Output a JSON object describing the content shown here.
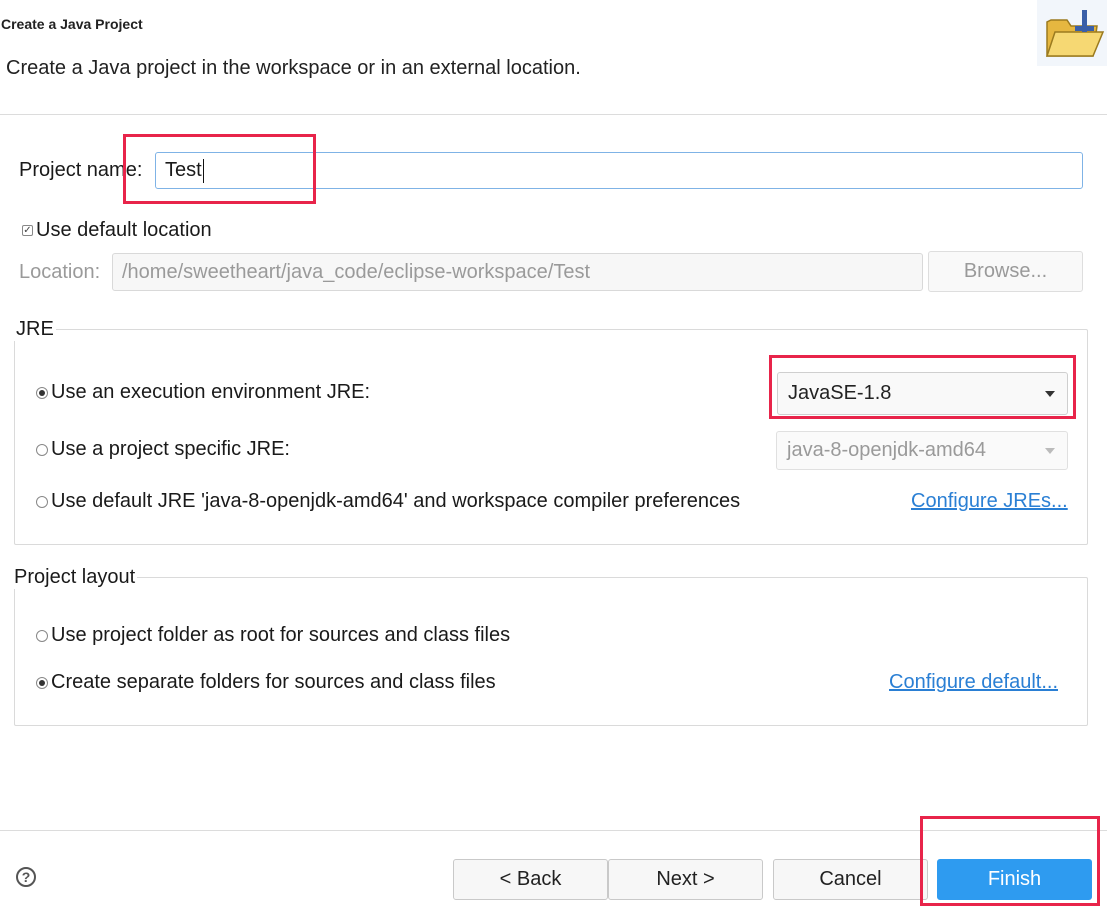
{
  "header": {
    "title": "Create a Java Project",
    "description": "Create a Java project in the workspace or in an external location.",
    "banner_icon": "new-java-project-folder-icon"
  },
  "project": {
    "name_label": "Project name:",
    "name_value": "Test"
  },
  "location": {
    "use_default_label": "Use default location",
    "use_default_checked": true,
    "label": "Location:",
    "value": "/home/sweetheart/java_code/eclipse-workspace/Test",
    "browse_label": "Browse..."
  },
  "jre": {
    "group_title": "JRE",
    "option_env_label": "Use an execution environment JRE:",
    "option_env_value": "JavaSE-1.8",
    "option_specific_label": "Use a project specific JRE:",
    "option_specific_value": "java-8-openjdk-amd64",
    "option_default_label": "Use default JRE 'java-8-openjdk-amd64' and workspace compiler preferences",
    "configure_link": "Configure JREs...",
    "selected": "execution_environment"
  },
  "layout": {
    "group_title": "Project layout",
    "option_root_label": "Use project folder as root for sources and class files",
    "option_separate_label": "Create separate folders for sources and class files",
    "configure_link": "Configure default...",
    "selected": "separate"
  },
  "footer": {
    "help_icon": "?",
    "back_label": "< Back",
    "next_label": "Next >",
    "cancel_label": "Cancel",
    "finish_label": "Finish"
  },
  "colors": {
    "highlight": "#e8244a",
    "primary_button": "#2e9bf0",
    "link": "#2a7fd4"
  }
}
